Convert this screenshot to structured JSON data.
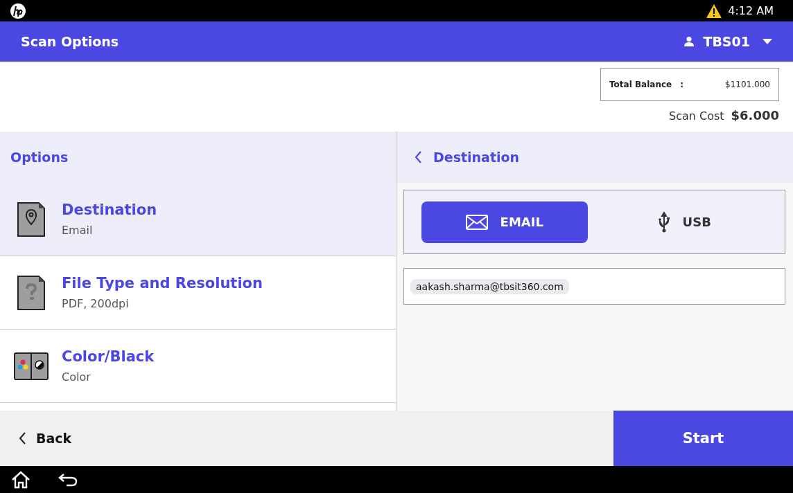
{
  "status_bar": {
    "time": "4:12 AM",
    "warning": true
  },
  "header": {
    "title": "Scan Options",
    "user": "TBS01"
  },
  "balance": {
    "label": "Total Balance",
    "separator": ":",
    "value": "$1101.000"
  },
  "scan_cost": {
    "label": "Scan Cost",
    "value": "$6.000"
  },
  "options": {
    "title": "Options",
    "items": [
      {
        "kind": "destination",
        "title": "Destination",
        "value": "Email",
        "selected": true
      },
      {
        "kind": "file-type",
        "title": "File Type and Resolution",
        "value": "PDF, 200dpi",
        "selected": false
      },
      {
        "kind": "color",
        "title": "Color/Black",
        "value": "Color",
        "selected": false
      }
    ]
  },
  "destination": {
    "title": "Destination",
    "choices": [
      {
        "kind": "email",
        "label": "EMAIL",
        "selected": true
      },
      {
        "kind": "usb",
        "label": "USB",
        "selected": false
      }
    ],
    "recipients": [
      "aakash.sharma@tbsit360.com"
    ]
  },
  "footer": {
    "back": "Back",
    "start": "Start"
  }
}
